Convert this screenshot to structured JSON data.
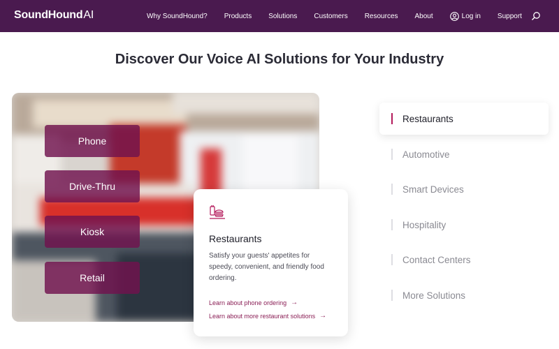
{
  "brand": {
    "name_main": "SoundHound",
    "name_suffix": "AI"
  },
  "nav": {
    "links": [
      "Why SoundHound?",
      "Products",
      "Solutions",
      "Customers",
      "Resources",
      "About"
    ],
    "login_label": "Log in",
    "support_label": "Support"
  },
  "page_title": "Discover Our Voice AI Solutions for Your Industry",
  "channels": [
    "Phone",
    "Drive-Thru",
    "Kiosk",
    "Retail"
  ],
  "card": {
    "icon": "food-tray-icon",
    "title": "Restaurants",
    "description": "Satisfy your guests' appetites for speedy, convenient, and friendly food ordering.",
    "link_phone": "Learn about phone ordering",
    "link_more": "Learn about more restaurant solutions"
  },
  "industries": {
    "active_index": 0,
    "items": [
      "Restaurants",
      "Automotive",
      "Smart Devices",
      "Hospitality",
      "Contact Centers",
      "More Solutions"
    ]
  },
  "colors": {
    "nav_bg": "#4a1a4f",
    "accent": "#b3195a",
    "link": "#8a1e55",
    "pill": "#70124e"
  }
}
